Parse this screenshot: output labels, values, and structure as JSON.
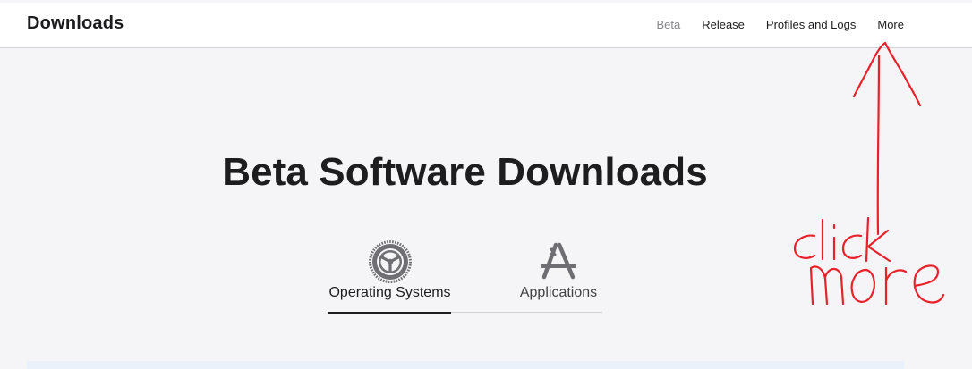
{
  "nav": {
    "title": "Downloads",
    "links": [
      {
        "label": "Beta",
        "current": true
      },
      {
        "label": "Release",
        "current": false
      },
      {
        "label": "Profiles and Logs",
        "current": false
      },
      {
        "label": "More",
        "current": false
      }
    ]
  },
  "hero": {
    "title": "Beta Software Downloads"
  },
  "tabs": [
    {
      "label": "Operating Systems",
      "icon": "gear-icon",
      "active": true
    },
    {
      "label": "Applications",
      "icon": "app-store-icon",
      "active": false
    }
  ],
  "annotation": {
    "text": "click more",
    "color": "#e8212b"
  },
  "colors": {
    "text": "#1d1d1f",
    "muted": "#86868b",
    "background": "#f5f5f7",
    "navbar": "#ffffff",
    "icon": "#6e6e73"
  }
}
